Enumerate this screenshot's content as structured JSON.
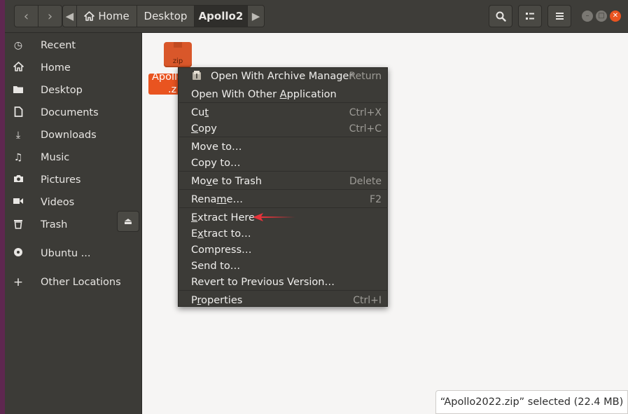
{
  "header": {
    "path": [
      "Home",
      "Desktop",
      "Apollo2"
    ]
  },
  "sidebar": {
    "items": [
      {
        "label": "Recent",
        "icon": "clock-icon"
      },
      {
        "label": "Home",
        "icon": "home-icon"
      },
      {
        "label": "Desktop",
        "icon": "folder-icon"
      },
      {
        "label": "Documents",
        "icon": "document-icon"
      },
      {
        "label": "Downloads",
        "icon": "download-icon"
      },
      {
        "label": "Music",
        "icon": "music-icon"
      },
      {
        "label": "Pictures",
        "icon": "camera-icon"
      },
      {
        "label": "Videos",
        "icon": "video-icon"
      },
      {
        "label": "Trash",
        "icon": "trash-icon"
      },
      {
        "label": "Ubuntu ...",
        "icon": "disc-icon"
      },
      {
        "label": "Other Locations",
        "icon": "plus-icon"
      }
    ]
  },
  "content": {
    "file": {
      "icon_text": "zip",
      "name_line1": "Apollo",
      "name_line2": ".z"
    },
    "status": "“Apollo2022.zip” selected  (22.4 MB)"
  },
  "menu": {
    "items": [
      {
        "pre": "Open With Archive Manager",
        "u": "",
        "post": "",
        "shortcut": "Return"
      },
      {
        "pre": "Open With Other ",
        "u": "A",
        "post": "pplication",
        "shortcut": ""
      },
      {
        "pre": "Cu",
        "u": "t",
        "post": "",
        "shortcut": "Ctrl+X"
      },
      {
        "pre": "",
        "u": "C",
        "post": "opy",
        "shortcut": "Ctrl+C"
      },
      {
        "pre": "Move to…",
        "u": "",
        "post": "",
        "shortcut": ""
      },
      {
        "pre": "Copy to…",
        "u": "",
        "post": "",
        "shortcut": ""
      },
      {
        "pre": "Mo",
        "u": "v",
        "post": "e to Trash",
        "shortcut": "Delete"
      },
      {
        "pre": "Rena",
        "u": "m",
        "post": "e…",
        "shortcut": "F2"
      },
      {
        "pre": "",
        "u": "E",
        "post": "xtract Here",
        "shortcut": ""
      },
      {
        "pre": "E",
        "u": "x",
        "post": "tract to…",
        "shortcut": ""
      },
      {
        "pre": "Compress…",
        "u": "",
        "post": "",
        "shortcut": ""
      },
      {
        "pre": "Send to…",
        "u": "",
        "post": "",
        "shortcut": ""
      },
      {
        "pre": "Revert to Previous Version…",
        "u": "",
        "post": "",
        "shortcut": ""
      },
      {
        "pre": "P",
        "u": "r",
        "post": "operties",
        "shortcut": "Ctrl+I"
      }
    ]
  },
  "colors": {
    "accent": "#e95420",
    "headerbar": "#3e3d39",
    "sidebar": "#3c3b37",
    "menu_bg": "#3c3b37",
    "annotation_arrow": "#e8333a"
  }
}
